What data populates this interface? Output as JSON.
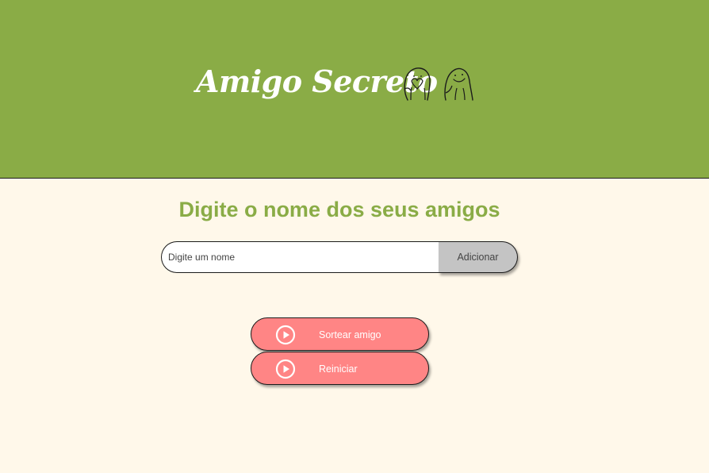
{
  "header": {
    "title": "Amigo Secreto",
    "mascot_icons": [
      "flork-heart-icon",
      "flork-smile-icon"
    ],
    "background_color": "#8aac46"
  },
  "main": {
    "section_title": "Digite o nome dos seus amigos",
    "name_input": {
      "placeholder": "Digite um nome",
      "value": ""
    },
    "add_button_label": "Adicionar",
    "draw_button": {
      "label": "Sortear amigo",
      "icon": "play-circle-icon"
    },
    "reset_button": {
      "label": "Reiniciar",
      "icon": "play-circle-icon"
    },
    "accent_color": "#ff8585",
    "title_color": "#8aac46",
    "background_color": "#fff8ea"
  }
}
